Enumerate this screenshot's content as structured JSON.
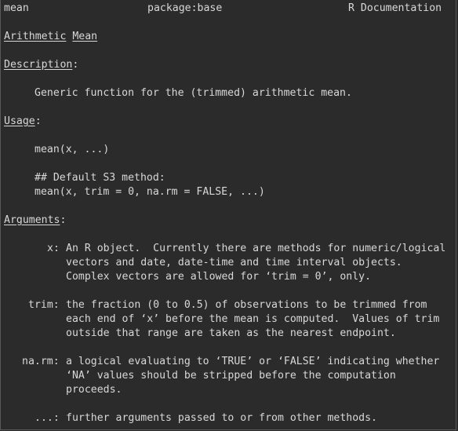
{
  "header": {
    "topic": "mean",
    "package": "package:base",
    "doc": "R Documentation"
  },
  "title": {
    "word1": "Arithmetic",
    "word2": "Mean"
  },
  "description": {
    "heading": "Description",
    "colon": ":",
    "text": "Generic function for the (trimmed) arithmetic mean."
  },
  "usage": {
    "heading": "Usage",
    "colon": ":",
    "line1": "mean(x, ...)",
    "line2": "## Default S3 method:",
    "line3": "mean(x, trim = 0, na.rm = FALSE, ...)"
  },
  "arguments": {
    "heading": "Arguments",
    "colon": ":",
    "items": [
      {
        "name": "x:",
        "lines": [
          "An R object.  Currently there are methods for numeric/logical",
          "vectors and date, date-time and time interval objects.",
          "Complex vectors are allowed for ‘trim = 0’, only."
        ]
      },
      {
        "name": "trim:",
        "lines": [
          "the fraction (0 to 0.5) of observations to be trimmed from",
          "each end of ‘x’ before the mean is computed.  Values of trim",
          "outside that range are taken as the nearest endpoint."
        ]
      },
      {
        "name": "na.rm:",
        "lines": [
          "a logical evaluating to ‘TRUE’ or ‘FALSE’ indicating whether",
          "‘NA’ values should be stripped before the computation",
          "proceeds."
        ]
      },
      {
        "name": "...:",
        "lines": [
          "further arguments passed to or from other methods."
        ]
      }
    ]
  }
}
